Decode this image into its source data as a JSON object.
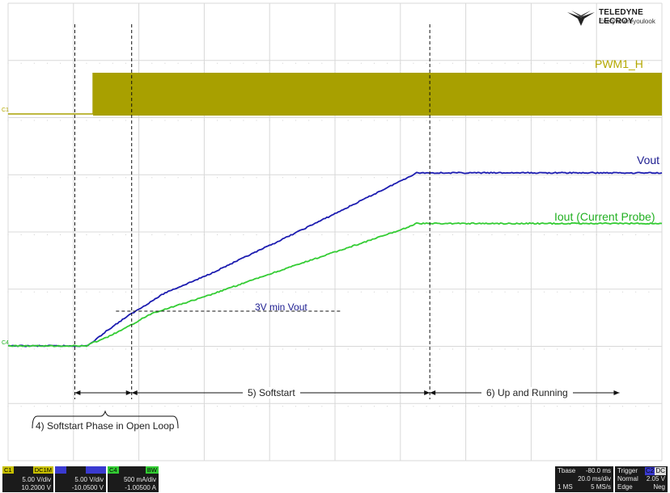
{
  "chart_data": {
    "type": "line",
    "title": "",
    "xlabel": "",
    "ylabel": "",
    "grid": true,
    "x_divisions": 10,
    "y_divisions": 8,
    "time_per_div_ms": 20,
    "series": [
      {
        "name": "PWM1_H",
        "channel": "C1",
        "color": "#a8a000",
        "kind": "pwm",
        "x": [
          0,
          1.3,
          1.3,
          10
        ],
        "y": [
          0.0,
          0.0,
          1.0,
          1.0
        ]
      },
      {
        "name": "Vout",
        "color": "#1c1cb0",
        "x": [
          0,
          1.2,
          1.3,
          1.5,
          1.8,
          2.2,
          2.4,
          3.0,
          4.0,
          5.0,
          6.0,
          6.25,
          10
        ],
        "y": [
          0.0,
          0.0,
          0.05,
          0.18,
          0.35,
          0.55,
          0.65,
          0.85,
          1.23,
          1.62,
          2.02,
          2.12,
          2.12
        ]
      },
      {
        "name": "Iout (Current Probe)",
        "color": "#33cc33",
        "x": [
          0,
          1.2,
          1.3,
          1.5,
          1.8,
          2.2,
          2.4,
          3.0,
          4.0,
          5.0,
          6.0,
          6.25,
          10
        ],
        "y": [
          0.0,
          0.0,
          0.04,
          0.1,
          0.22,
          0.4,
          0.45,
          0.6,
          0.88,
          1.15,
          1.42,
          1.5,
          1.5
        ]
      }
    ],
    "annotations": [
      {
        "text": "3V min Vout"
      },
      {
        "text": "4)  Softstart Phase in Open Loop"
      },
      {
        "text": "5)    Softstart"
      },
      {
        "text": "6)   Up and Running"
      }
    ]
  },
  "labels": {
    "pwm": "PWM1_H",
    "vout": "Vout",
    "iout": "Iout (Current Probe)",
    "min_vout": "3V min Vout",
    "phase4": "4)  Softstart Phase in Open Loop",
    "phase5": "5)    Softstart",
    "phase6": "6)   Up and Running",
    "marker_c1": "C1",
    "marker_c4": "C4"
  },
  "logo": {
    "brand": "TELEDYNE LECROY",
    "tagline": "Everywhereyoulook"
  },
  "channels": [
    {
      "id": "C1",
      "coupling": "DC1M",
      "scale": "5.00 V/div",
      "offset": "10.2000 V",
      "color": "#c8c000"
    },
    {
      "id": "C2",
      "coupling": "DC1M",
      "scale": "5.00 V/div",
      "offset": "-10.0500 V",
      "color": "#3a3ad0"
    },
    {
      "id": "C4",
      "coupling": "BW",
      "scale": "500 mA/div",
      "offset": "-1.00500 A",
      "color": "#33cc33"
    }
  ],
  "timebase": {
    "label": "Tbase",
    "delay": "-80.0 ms",
    "per_div": "20.0 ms/div",
    "points": "1 MS",
    "rate": "5 MS/s"
  },
  "trigger": {
    "label": "Trigger",
    "source": "C2",
    "coupling": "DC",
    "mode": "Normal",
    "level": "2.05 V",
    "type": "Edge",
    "slope": "Neg"
  },
  "colors": {
    "pwm": "#a8a000",
    "vout": "#1c1cb0",
    "iout": "#33cc33",
    "grid": "#d8d8d8"
  }
}
